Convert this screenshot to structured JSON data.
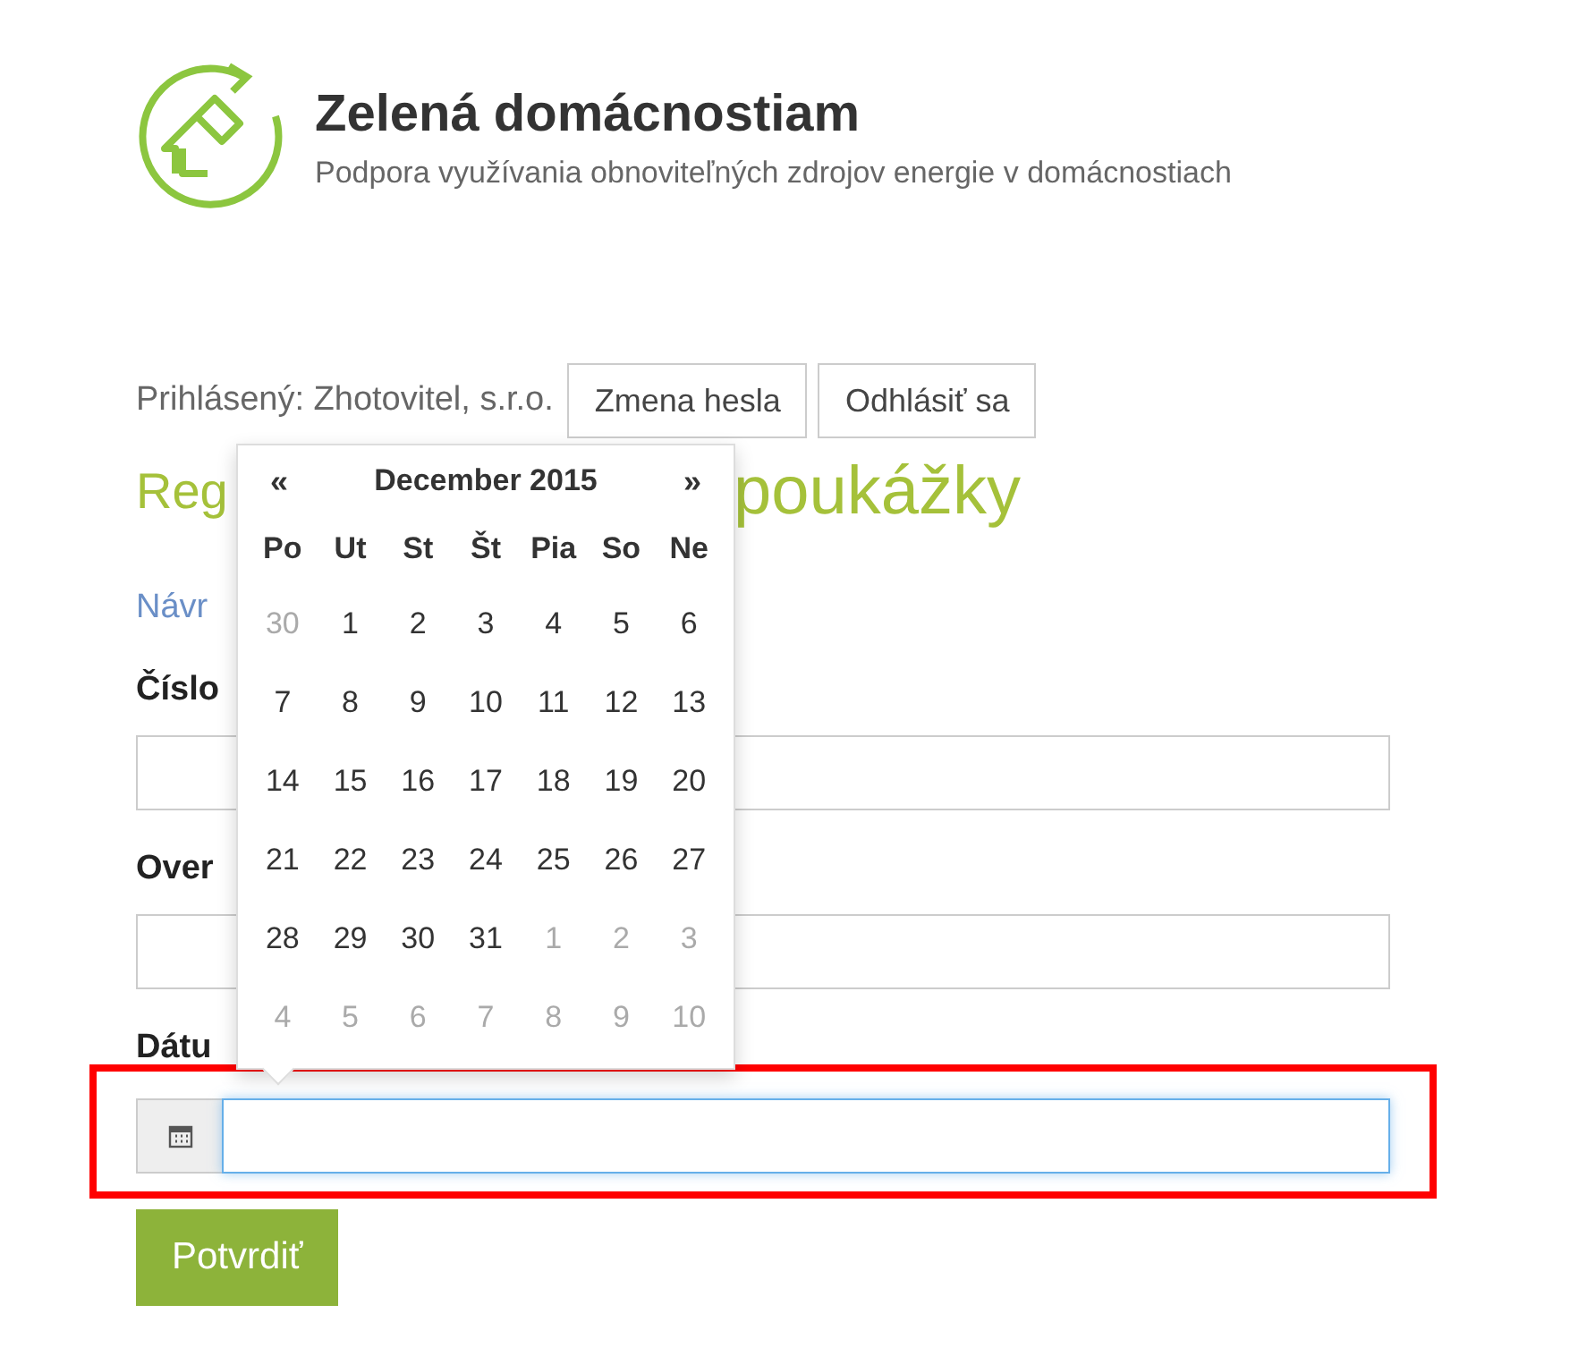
{
  "header": {
    "title": "Zelená domácnostiam",
    "subtitle": "Podpora využívania obnoviteľných zdrojov energie v domácnostiach"
  },
  "login": {
    "text": "Prihlásený: Zhotovitel, s.r.o.",
    "buttons": [
      "Zmena hesla",
      "Odhlásiť sa"
    ]
  },
  "heading": {
    "visible_start": "Reg",
    "visible_end": "poukážky"
  },
  "link_fragment": "Návr",
  "fields": [
    {
      "label": "Číslo",
      "kind": "text"
    },
    {
      "label": "Over",
      "kind": "text"
    },
    {
      "label": "Dátu",
      "kind": "date"
    }
  ],
  "datepicker": {
    "prev": "«",
    "title": "December 2015",
    "next": "»",
    "weekdays": [
      "Po",
      "Ut",
      "St",
      "Št",
      "Pia",
      "So",
      "Ne"
    ],
    "weeks": [
      [
        {
          "day": "30",
          "other_month": true
        },
        {
          "day": "1",
          "other_month": false
        },
        {
          "day": "2",
          "other_month": false
        },
        {
          "day": "3",
          "other_month": false
        },
        {
          "day": "4",
          "other_month": false
        },
        {
          "day": "5",
          "other_month": false
        },
        {
          "day": "6",
          "other_month": false
        }
      ],
      [
        {
          "day": "7",
          "other_month": false
        },
        {
          "day": "8",
          "other_month": false
        },
        {
          "day": "9",
          "other_month": false
        },
        {
          "day": "10",
          "other_month": false
        },
        {
          "day": "11",
          "other_month": false
        },
        {
          "day": "12",
          "other_month": false
        },
        {
          "day": "13",
          "other_month": false
        }
      ],
      [
        {
          "day": "14",
          "other_month": false
        },
        {
          "day": "15",
          "other_month": false
        },
        {
          "day": "16",
          "other_month": false
        },
        {
          "day": "17",
          "other_month": false
        },
        {
          "day": "18",
          "other_month": false
        },
        {
          "day": "19",
          "other_month": false
        },
        {
          "day": "20",
          "other_month": false
        }
      ],
      [
        {
          "day": "21",
          "other_month": false
        },
        {
          "day": "22",
          "other_month": false
        },
        {
          "day": "23",
          "other_month": false
        },
        {
          "day": "24",
          "other_month": false
        },
        {
          "day": "25",
          "other_month": false
        },
        {
          "day": "26",
          "other_month": false
        },
        {
          "day": "27",
          "other_month": false
        }
      ],
      [
        {
          "day": "28",
          "other_month": false
        },
        {
          "day": "29",
          "other_month": false
        },
        {
          "day": "30",
          "other_month": false
        },
        {
          "day": "31",
          "other_month": false
        },
        {
          "day": "1",
          "other_month": true
        },
        {
          "day": "2",
          "other_month": true
        },
        {
          "day": "3",
          "other_month": true
        }
      ],
      [
        {
          "day": "4",
          "other_month": true
        },
        {
          "day": "5",
          "other_month": true
        },
        {
          "day": "6",
          "other_month": true
        },
        {
          "day": "7",
          "other_month": true
        },
        {
          "day": "8",
          "other_month": true
        },
        {
          "day": "9",
          "other_month": true
        },
        {
          "day": "10",
          "other_month": true
        }
      ]
    ]
  },
  "submit": "Potvrdiť"
}
